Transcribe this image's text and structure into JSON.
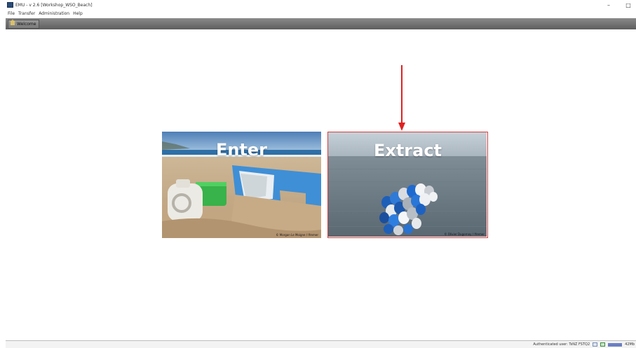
{
  "window": {
    "title": "EMU - v 2.6 [Workshop_WSO_Beach]",
    "controls": {
      "minimize": "–",
      "maximize": "□"
    }
  },
  "menu": [
    "File",
    "Transfer",
    "Administration",
    "Help"
  ],
  "toolbar": {
    "tab_label": "Welcome",
    "tab_icon": "home-icon"
  },
  "tiles": {
    "enter": {
      "title": "Enter",
      "credit": "© Morgan Le Moigne / Ifremer"
    },
    "extract": {
      "title": "Extract",
      "credit": "© Olivier Dugornay / Ifremer"
    }
  },
  "annotation": {
    "arrow_color": "#e02020",
    "highlight_color": "#e03a3a"
  },
  "status": {
    "user_text": "Authenticated user: TsNZ FSTQ2",
    "memory": "42Mb"
  }
}
